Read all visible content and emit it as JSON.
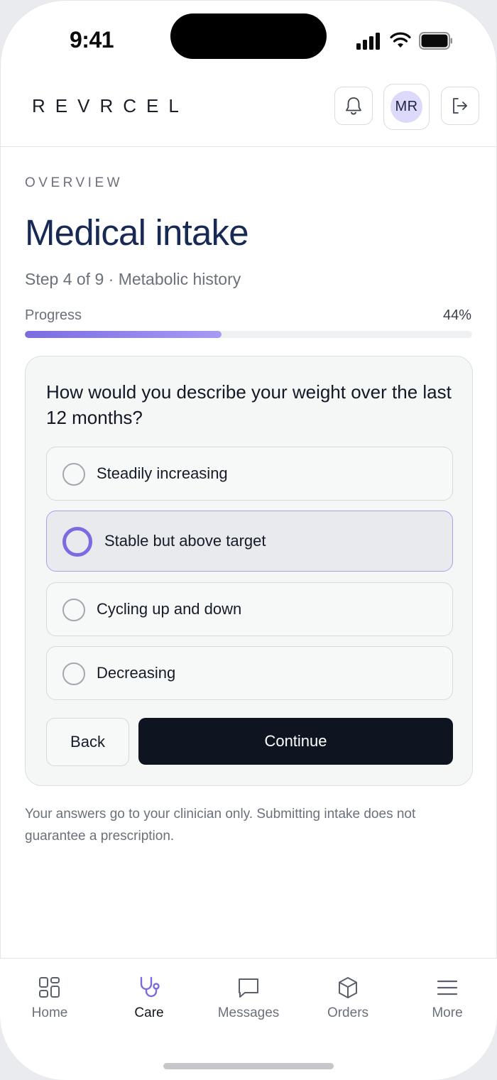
{
  "status_bar": {
    "time": "9:41"
  },
  "header": {
    "brand": "REVRCEL",
    "avatar_initials": "MR",
    "icons": {
      "notifications": "bell-icon",
      "logout": "logout-icon"
    }
  },
  "page": {
    "eyebrow": "OVERVIEW",
    "title": "Medical intake",
    "step": "Step 4 of 9 · Metabolic history",
    "progress_label": "Progress",
    "progress_value": "44%",
    "progress_fraction": 0.44
  },
  "question": {
    "text": "How would you describe your weight over the last 12 months?",
    "options": [
      {
        "label": "Steadily increasing",
        "selected": false
      },
      {
        "label": "Stable but above target",
        "selected": true
      },
      {
        "label": "Cycling up and down",
        "selected": false
      },
      {
        "label": "Decreasing",
        "selected": false
      }
    ],
    "back_label": "Back",
    "continue_label": "Continue"
  },
  "disclaimer": "Your answers go to your clinician only. Submitting intake does not guarantee a prescription.",
  "nav": {
    "items": [
      {
        "label": "Home",
        "icon": "grid-icon",
        "active": false
      },
      {
        "label": "Care",
        "icon": "stethoscope-icon",
        "active": true
      },
      {
        "label": "Messages",
        "icon": "chat-icon",
        "active": false
      },
      {
        "label": "Orders",
        "icon": "box-icon",
        "active": false
      },
      {
        "label": "More",
        "icon": "menu-icon",
        "active": false
      }
    ]
  },
  "colors": {
    "accent": "#7a6ce0",
    "title": "#172a55",
    "primary_button": "#0e1420",
    "avatar_bg": "#ddd9fb"
  }
}
